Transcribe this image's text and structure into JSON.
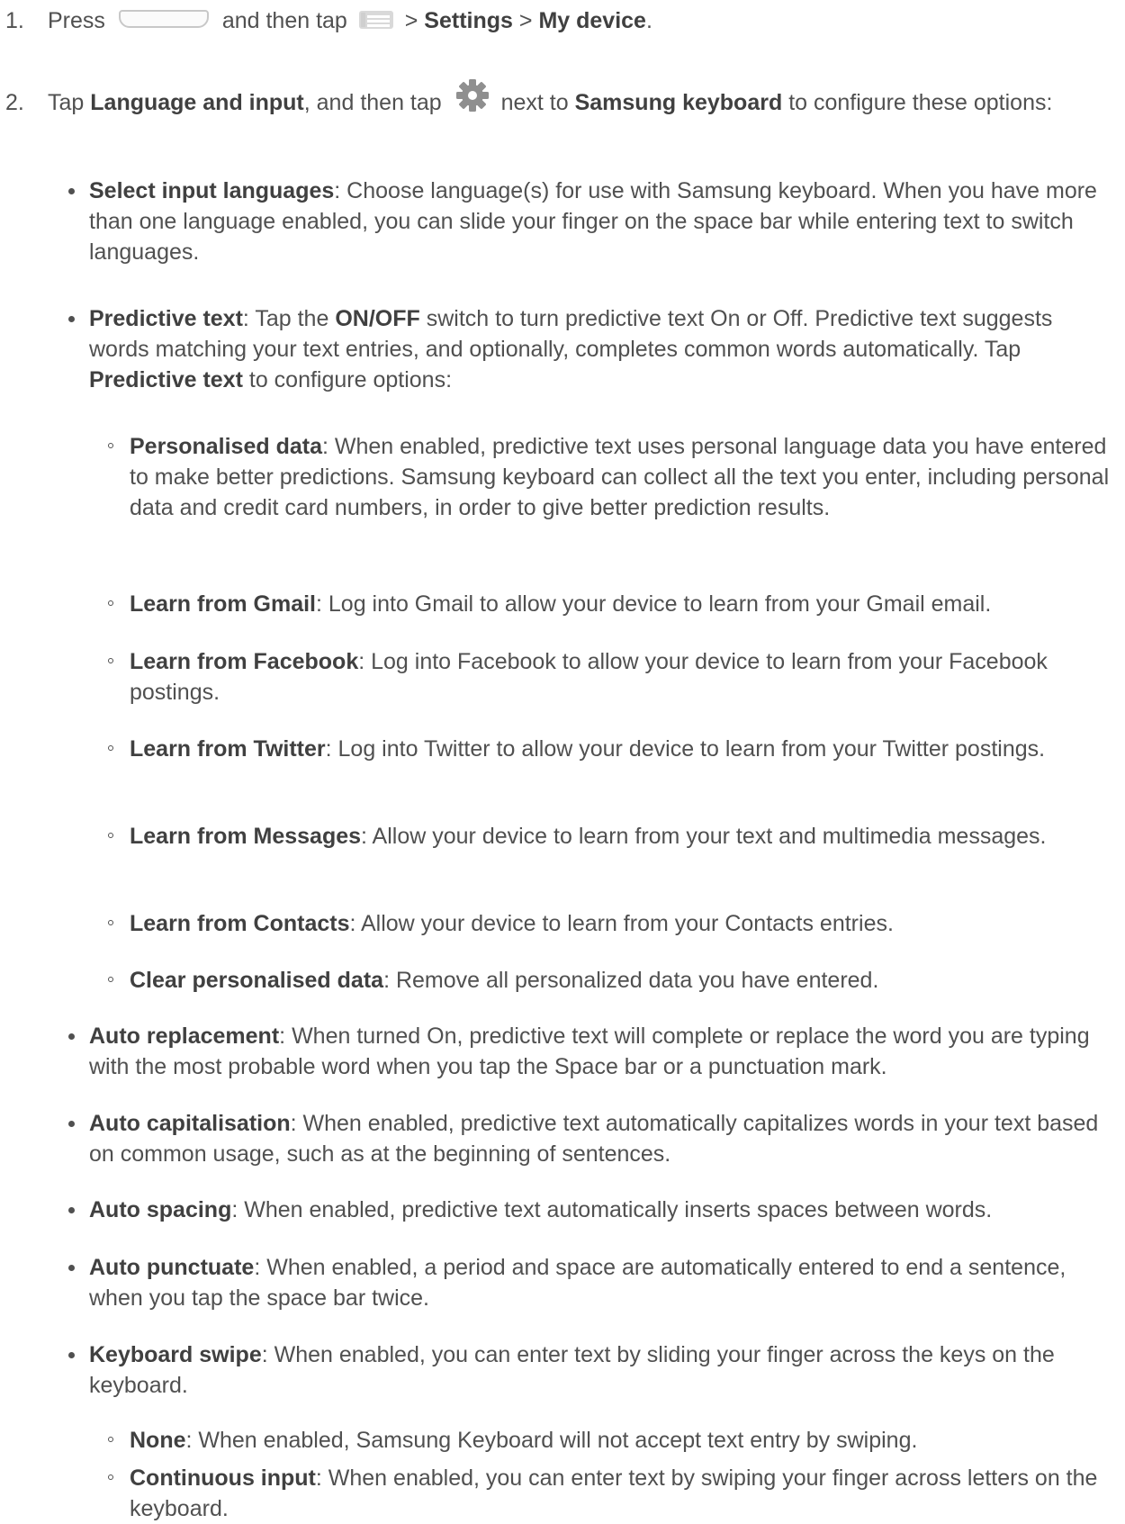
{
  "steps": [
    {
      "num": "1.",
      "t1": "Press",
      "t2": "and then tap",
      "t3": ">",
      "b1": "Settings",
      "t4": ">",
      "b2": "My device",
      "t5": "."
    },
    {
      "num": "2.",
      "t1": "Tap",
      "b1": "Language and input",
      "t2": ", and then tap",
      "t3": "next to",
      "b2": "Samsung keyboard",
      "t4": "to configure these options:"
    }
  ],
  "items": [
    {
      "title": "Select input languages",
      "text": ": Choose language(s) for use with Samsung keyboard. When you have more than one language enabled, you can slide your finger on the space bar while entering text to switch languages."
    },
    {
      "title": "Predictive text",
      "t1": ": Tap the",
      "b1": "ON/OFF",
      "t2": "switch to turn predictive text On or Off. Predictive text suggests words matching your text entries, and optionally, completes common words automatically. Tap",
      "b2": "Predictive text",
      "t3": "to configure options:"
    },
    {
      "title": "Auto replacement",
      "text": ": When turned On, predictive text will complete or replace the word you are typing with the most probable word when you tap the Space bar or a punctuation mark."
    },
    {
      "title": "Auto capitalisation",
      "text": ": When enabled, predictive text automatically capitalizes words in your text based on common usage, such as at the beginning of sentences."
    },
    {
      "title": "Auto spacing",
      "text": ": When enabled, predictive text automatically inserts spaces between words."
    },
    {
      "title": "Auto punctuate",
      "text": ": When enabled, a period and space are automatically entered to end a sentence, when you tap the space bar twice."
    },
    {
      "title": "Keyboard swipe",
      "text": ": When enabled, you can enter text by sliding your finger across the keys on the keyboard."
    }
  ],
  "predictive_sub": [
    {
      "title": "Personalised data",
      "text": ": When enabled, predictive text uses personal language data you have entered to make better predictions. Samsung keyboard can collect all the text you enter, including personal data and credit card numbers, in order to give better prediction results."
    },
    {
      "title": "Learn from Gmail",
      "text": ": Log into Gmail to allow your device to learn from your Gmail email."
    },
    {
      "title": "Learn from Facebook",
      "text": ": Log into Facebook to allow your device to learn from your Facebook postings."
    },
    {
      "title": "Learn from Twitter",
      "text": ": Log into Twitter to allow your device to learn from your Twitter postings."
    },
    {
      "title": "Learn from Messages",
      "text": ": Allow your device to learn from your text and multimedia messages."
    },
    {
      "title": "Learn from Contacts",
      "text": ": Allow your device to learn from your Contacts entries."
    },
    {
      "title": "Clear personalised data",
      "text": ": Remove all personalized data you have entered."
    }
  ],
  "swipe_sub": [
    {
      "title": "None",
      "text": ": When enabled, Samsung Keyboard will not accept text entry by swiping."
    },
    {
      "title": "Continuous input",
      "text": ": When enabled, you can enter text by swiping your finger across letters on the keyboard."
    }
  ],
  "icons": {
    "home_button": "home-button-icon",
    "menu": "menu-icon",
    "settings": "gear-icon"
  }
}
